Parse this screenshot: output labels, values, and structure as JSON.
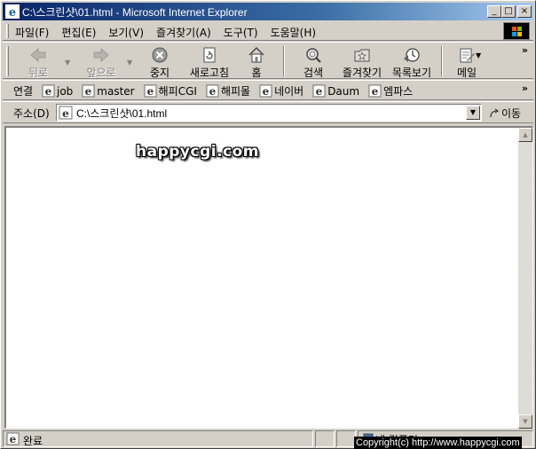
{
  "window": {
    "title": "C:\\스크린샷\\01.html - Microsoft Internet Explorer",
    "controls": {
      "minimize": "_",
      "maximize": "□",
      "close": "×"
    }
  },
  "menu": {
    "items": [
      {
        "label": "파일(F)"
      },
      {
        "label": "편집(E)"
      },
      {
        "label": "보기(V)"
      },
      {
        "label": "즐겨찾기(A)"
      },
      {
        "label": "도구(T)"
      },
      {
        "label": "도움말(H)"
      }
    ]
  },
  "toolbar": {
    "back": "뒤로",
    "forward": "앞으로",
    "stop": "중지",
    "refresh": "새로고침",
    "home": "홈",
    "search": "검색",
    "favorites": "즐겨찾기",
    "history": "목록보기",
    "mail": "메일",
    "more": "»"
  },
  "links": {
    "label": "연결",
    "items": [
      {
        "label": "job"
      },
      {
        "label": "master"
      },
      {
        "label": "해피CGI"
      },
      {
        "label": "해피몰"
      },
      {
        "label": "네이버"
      },
      {
        "label": "Daum"
      },
      {
        "label": "엠파스"
      }
    ],
    "more": "»"
  },
  "address": {
    "label": "주소(D)",
    "value": "C:\\스크린샷\\01.html",
    "go": "이동"
  },
  "content": {
    "watermark": "happycgi.com"
  },
  "status": {
    "text": "완료",
    "zone": "내 컴퓨터"
  },
  "overlay": {
    "copyright": "Copyright(c) http://www.happycgi.com"
  },
  "colors": {
    "titlebar_start": "#0a246a",
    "titlebar_end": "#a6caf0",
    "chrome": "#d4d0c8"
  }
}
